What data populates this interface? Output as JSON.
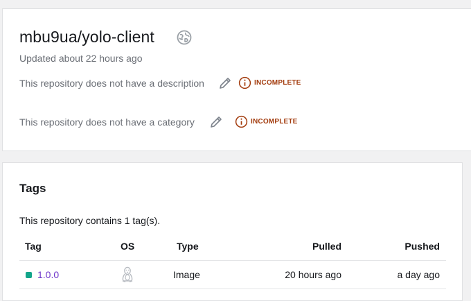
{
  "repo": {
    "title": "mbu9ua/yolo-client",
    "updated": "Updated about 22 hours ago",
    "description_text": "This repository does not have a description",
    "category_text": "This repository does not have a category",
    "incomplete_label": "INCOMPLETE",
    "visibility_icon": "public-globe-icon"
  },
  "tags": {
    "heading": "Tags",
    "summary": "This repository contains 1 tag(s).",
    "columns": [
      "Tag",
      "OS",
      "Type",
      "Pulled",
      "Pushed"
    ],
    "rows": [
      {
        "tag": "1.0.0",
        "os": "linux-icon",
        "type": "Image",
        "pulled": "20 hours ago",
        "pushed": "a day ago",
        "status_color": "#13a58a"
      }
    ]
  },
  "colors": {
    "accent_link": "#6d34c9",
    "incomplete": "#a33c0e",
    "status_active": "#13a58a"
  }
}
